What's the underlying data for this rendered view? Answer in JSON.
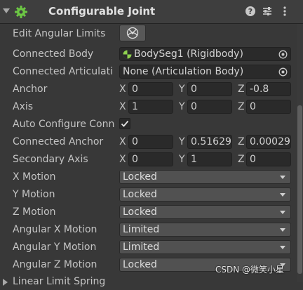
{
  "header": {
    "title": "Configurable Joint",
    "component_icon": "joint-gear-icon",
    "help_icon": "help-icon",
    "preset_icon": "sliders-icon",
    "menu_icon": "kebab-menu-icon"
  },
  "rows": {
    "edit_angular_limits": {
      "label": "Edit Angular Limits",
      "button_icon": "angular-limits-edit-icon"
    },
    "connected_body": {
      "label": "Connected Body",
      "value": "BodySeg1 (Rigidbody)"
    },
    "connected_articulation": {
      "label": "Connected Articulati",
      "value": "None (Articulation Body)"
    },
    "anchor": {
      "label": "Anchor",
      "x": "0",
      "y": "0",
      "z": "-0.8"
    },
    "axis": {
      "label": "Axis",
      "x": "1",
      "y": "0",
      "z": "0"
    },
    "auto_configure": {
      "label": "Auto Configure Conn",
      "checked": true
    },
    "connected_anchor": {
      "label": "Connected Anchor",
      "x": "0",
      "y": "0.51629",
      "z": "0.00029"
    },
    "secondary_axis": {
      "label": "Secondary Axis",
      "x": "0",
      "y": "1",
      "z": "0"
    },
    "x_motion": {
      "label": "X Motion",
      "value": "Locked"
    },
    "y_motion": {
      "label": "Y Motion",
      "value": "Locked"
    },
    "z_motion": {
      "label": "Z Motion",
      "value": "Locked"
    },
    "angular_x_motion": {
      "label": "Angular X Motion",
      "value": "Limited"
    },
    "angular_y_motion": {
      "label": "Angular Y Motion",
      "value": "Limited"
    },
    "angular_z_motion": {
      "label": "Angular Z Motion",
      "value": "Locked"
    },
    "linear_limit_spring": {
      "label": "Linear Limit Spring"
    }
  },
  "axis_labels": {
    "x": "X",
    "y": "Y",
    "z": "Z"
  },
  "watermark": "CSDN @微笑小星",
  "colors": {
    "background": "#383838",
    "field": "#2a2a2a",
    "dropdown": "#515151",
    "accent_green": "#8fd14f"
  }
}
